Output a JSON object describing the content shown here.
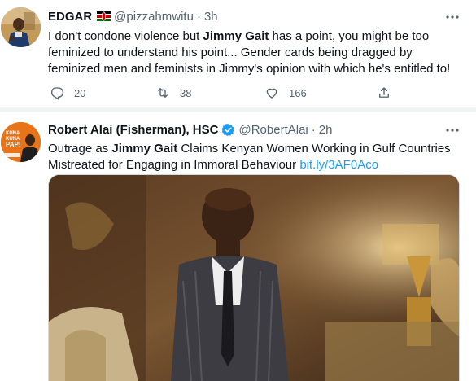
{
  "tweets": [
    {
      "name": "EDGAR",
      "flag_icon": "kenya-flag-icon",
      "handle": "@pizzahmwitu",
      "dot": "·",
      "time": "3h",
      "text_parts": [
        "I don't condone violence but ",
        "Jimmy Gait",
        " has a point, you might be too feminized to understand his point... Gender cards being dragged by feminized men and feminists in Jimmy's opinion with which he's entitled to!"
      ],
      "reply_count": "20",
      "retweet_count": "38",
      "like_count": "166"
    },
    {
      "name": "Robert Alai (Fisherman), HSC",
      "handle": "@RobertAlai",
      "dot": "·",
      "time": "2h",
      "text_parts": [
        "Outrage as ",
        "Jimmy Gait",
        " Claims Kenyan Women Working in Gulf Countries Mistreated for Engaging in Immoral Behaviour ",
        "bit.ly/3AF0Aco"
      ],
      "avatar_text": [
        "KUNA",
        "KUNA",
        "PAP!"
      ]
    }
  ],
  "colors": {
    "accent": "#1d9bf0",
    "secondary_text": "#536471",
    "primary_text": "#0f1419"
  }
}
